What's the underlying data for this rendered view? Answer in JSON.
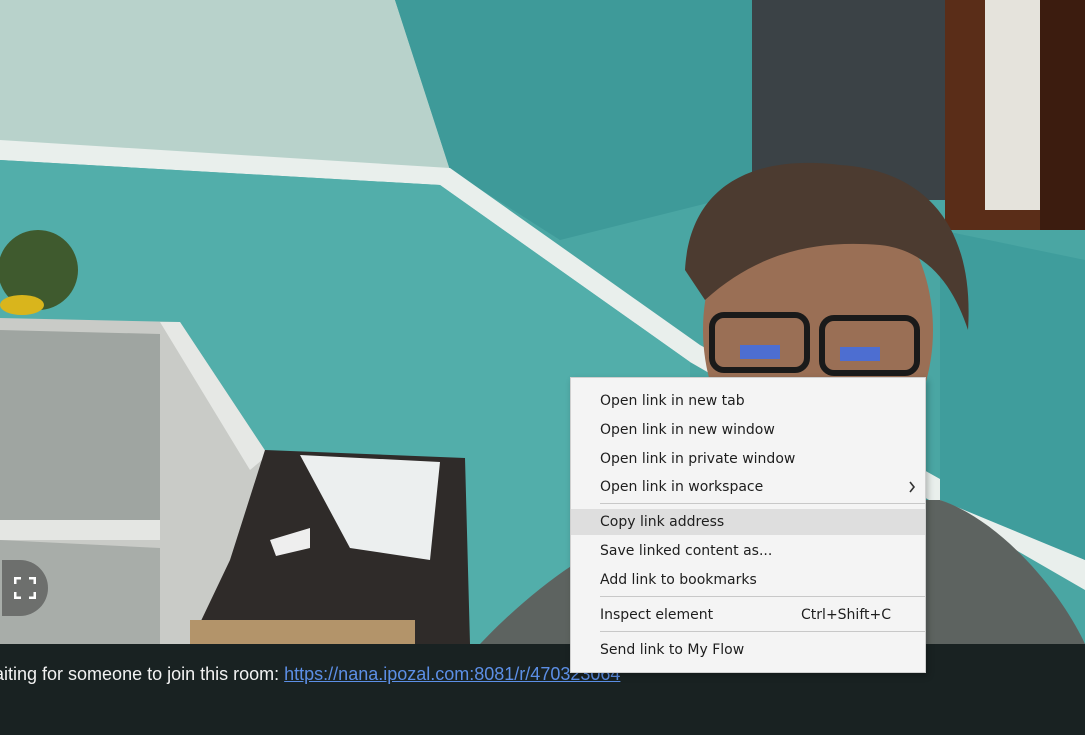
{
  "info_bar": {
    "message": "aiting for someone to join this room: ",
    "room_link": "https://nana.ipozal.com:8081/r/470323064"
  },
  "fullscreen_button": {
    "icon": "fullscreen-icon"
  },
  "context_menu": {
    "items": [
      {
        "label": "Open link in new tab"
      },
      {
        "label": "Open link in new window"
      },
      {
        "label": "Open link in private window"
      },
      {
        "label": "Open link in workspace",
        "submenu_icon": "chevron-right-icon"
      },
      {
        "label": "Copy link address",
        "highlighted": true
      },
      {
        "label": "Save linked content as..."
      },
      {
        "label": "Add link to bookmarks"
      },
      {
        "label": "Inspect element",
        "shortcut": "Ctrl+Shift+C"
      },
      {
        "label": "Send link to My Flow"
      }
    ]
  },
  "colors": {
    "wall": "#4fa9a6",
    "menu_background": "#f4f4f4",
    "menu_highlight": "#dedede",
    "link": "#5c8fe6",
    "info_bar_background": "#141414"
  }
}
